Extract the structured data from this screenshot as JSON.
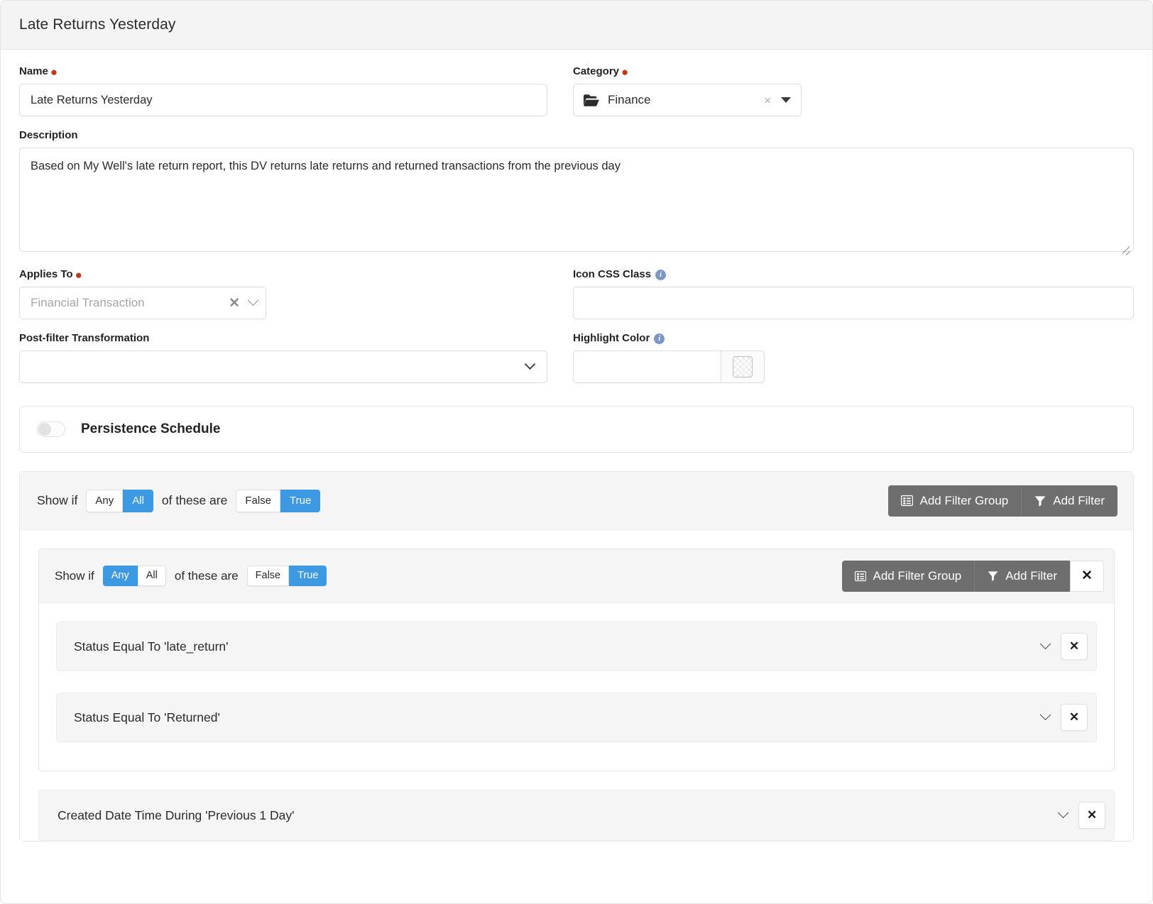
{
  "header": {
    "title": "Late Returns Yesterday"
  },
  "form": {
    "name": {
      "label": "Name",
      "required": true,
      "value": "Late Returns Yesterday"
    },
    "category": {
      "label": "Category",
      "required": true,
      "value": "Finance",
      "icon": "folder-icon",
      "clear": "×",
      "caret": "caret-down-icon"
    },
    "description": {
      "label": "Description",
      "value": "Based on My Well's late return report, this DV returns late returns and returned transactions from the previous day"
    },
    "applies_to": {
      "label": "Applies To",
      "required": true,
      "value": "Financial Transaction",
      "clear": "✕",
      "chevron": "chevron-down-icon"
    },
    "icon_css_class": {
      "label": "Icon CSS Class",
      "info": "i",
      "value": ""
    },
    "post_filter_transformation": {
      "label": "Post-filter Transformation",
      "value": ""
    },
    "highlight_color": {
      "label": "Highlight Color",
      "info": "i",
      "value": ""
    },
    "persistence_schedule": {
      "label": "Persistence Schedule",
      "enabled": false
    }
  },
  "filters": {
    "outer": {
      "show_if_label": "Show if",
      "of_these_are_label": "of these are",
      "match_options": [
        "Any",
        "All"
      ],
      "match_selected": "All",
      "truth_options": [
        "False",
        "True"
      ],
      "truth_selected": "True",
      "add_filter_group_label": "Add Filter Group",
      "add_filter_label": "Add Filter"
    },
    "inner": {
      "show_if_label": "Show if",
      "of_these_are_label": "of these are",
      "match_options": [
        "Any",
        "All"
      ],
      "match_selected": "Any",
      "truth_options": [
        "False",
        "True"
      ],
      "truth_selected": "True",
      "add_filter_group_label": "Add Filter Group",
      "add_filter_label": "Add Filter",
      "remove_label": "✕",
      "rows": [
        {
          "text": "Status Equal To 'late_return'",
          "remove_label": "✕"
        },
        {
          "text": "Status Equal To 'Returned'",
          "remove_label": "✕"
        }
      ]
    },
    "outer_rows": [
      {
        "text": "Created Date Time During 'Previous 1 Day'",
        "remove_label": "✕"
      }
    ]
  },
  "colors": {
    "accent_blue": "#3d9ae2",
    "button_gray": "#6e6e6e",
    "required_red": "#c0391b",
    "info_blue": "#7b96c4",
    "panel_gray": "#f5f5f5"
  }
}
